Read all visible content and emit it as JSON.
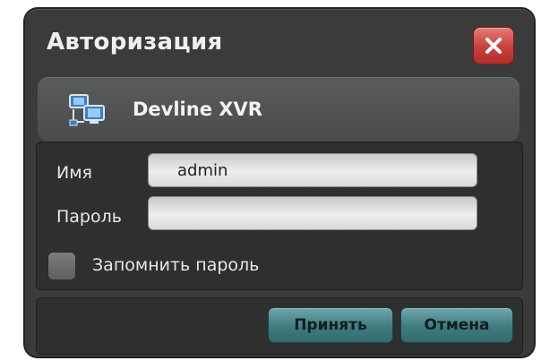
{
  "dialog": {
    "title": "Авторизация",
    "close_icon": "close-icon",
    "close_color": "#c8413c"
  },
  "server": {
    "icon": "network-computer-icon",
    "name": "Devline XVR"
  },
  "form": {
    "username_label": "Имя",
    "username_value": "admin",
    "password_label": "Пароль",
    "password_value": "",
    "remember_label": "Запомнить пароль",
    "remember_checked": false
  },
  "buttons": {
    "ok_label": "Принять",
    "cancel_label": "Отмена",
    "accent": "#3f7b80"
  }
}
